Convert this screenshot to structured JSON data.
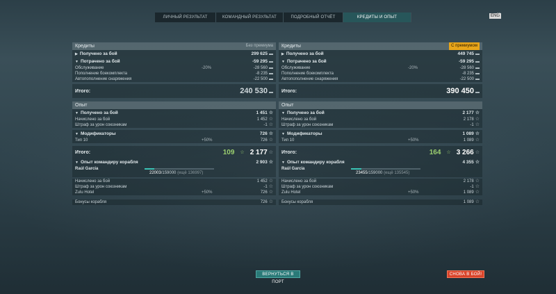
{
  "tabs": [
    {
      "label": "ЛИЧНЫЙ РЕЗУЛЬТАТ"
    },
    {
      "label": "КОМАНДНЫЙ РЕЗУЛЬТАТ"
    },
    {
      "label": "ПОДРОБНЫЙ ОТЧЁТ"
    },
    {
      "label": "КРЕДИТЫ И ОПЫТ"
    }
  ],
  "lang_badge": "ENG",
  "close_glyph": "×",
  "left": {
    "credits_header": "Кредиты",
    "credits_tag": "Без премиума",
    "earned_label": "Получено за бой",
    "earned_value": "299 625",
    "spent_label": "Потрачено за бой",
    "spent_value": "-59 295",
    "maintenance_label": "Обслуживание",
    "maintenance_mod": "-20%",
    "maintenance_value": "-28 560",
    "ammo_label": "Пополнение боекомплекта",
    "ammo_value": "-8 235",
    "consumables_label": "Автопополнение снаряжения",
    "consumables_value": "-22 500",
    "total_label": "Итого:",
    "total_value": "240 530",
    "exp_header": "Опыт",
    "exp_earned_label": "Получено за бой",
    "exp_earned_value": "1 451",
    "exp_accrued_label": "Начислено за бой",
    "exp_accrued_value": "1 452",
    "exp_penalty_label": "Штраф за урон союзникам",
    "exp_penalty_value": "-1",
    "mods_label": "Модификаторы",
    "mods_value": "726",
    "tier_label": "Тип 10",
    "tier_mod": "+50%",
    "tier_value": "726",
    "exp_total_label": "Итого:",
    "exp_total_free": "109",
    "exp_total_value": "2 177",
    "cmdr_label": "Опыт командиру корабля",
    "cmdr_value": "2 903",
    "captain_name": "Raúl Garcia",
    "cmdr_progress_current": "22003",
    "cmdr_progress_max": "/159000",
    "cmdr_progress_rest": "(ещё 136997)",
    "cmdr_progress_fraction": 0.138,
    "cmdr_accrued_label": "Начислено за бой",
    "cmdr_accrued_value": "1 452",
    "cmdr_penalty_label": "Штраф за урон союзникам",
    "cmdr_penalty_value": "-1",
    "zulu_label": "Zulu Hotel",
    "zulu_mod": "+50%",
    "zulu_value": "726",
    "bonus_label": "Бонусы корабля",
    "bonus_value": "726"
  },
  "right": {
    "credits_header": "Кредиты",
    "credits_tag": "С премиумом",
    "earned_label": "Получено за бой",
    "earned_value": "449 745",
    "spent_label": "Потрачено за бой",
    "spent_value": "-59 295",
    "maintenance_label": "Обслуживание",
    "maintenance_mod": "-20%",
    "maintenance_value": "-28 560",
    "ammo_label": "Пополнение боекомплекта",
    "ammo_value": "-8 235",
    "consumables_label": "Автопополнение снаряжения",
    "consumables_value": "-22 500",
    "total_label": "Итого:",
    "total_value": "390 450",
    "exp_header": "Опыт",
    "exp_earned_label": "Получено за бой",
    "exp_earned_value": "2 177",
    "exp_accrued_label": "Начислено за бой",
    "exp_accrued_value": "2 178",
    "exp_penalty_label": "Штраф за урон союзникам",
    "exp_penalty_value": "-1",
    "mods_label": "Модификаторы",
    "mods_value": "1 089",
    "tier_label": "Тип 10",
    "tier_mod": "+50%",
    "tier_value": "1 089",
    "exp_total_label": "Итого:",
    "exp_total_free": "164",
    "exp_total_value": "3 266",
    "cmdr_label": "Опыт командиру корабля",
    "cmdr_value": "4 355",
    "captain_name": "Raúl Garcia",
    "cmdr_progress_current": "23455",
    "cmdr_progress_max": "/159000",
    "cmdr_progress_rest": "(ещё 135545)",
    "cmdr_progress_fraction": 0.148,
    "cmdr_accrued_label": "Начислено за бой",
    "cmdr_accrued_value": "2 178",
    "cmdr_penalty_label": "Штраф за урон союзникам",
    "cmdr_penalty_value": "-1",
    "zulu_label": "Zulu Hotel",
    "zulu_mod": "+50%",
    "zulu_value": "1 089",
    "bonus_label": "Бонусы корабля",
    "bonus_value": "1 089"
  },
  "buttons": {
    "port": "ВЕРНУТЬСЯ В ПОРТ",
    "battle": "СНОВА В БОЙ!"
  },
  "colors": {
    "premium_tag": "#e8a51a",
    "active_tab": "#27565a",
    "port_button": "#2a7a78",
    "battle_button": "#d9442a",
    "free_exp": "#9bcf6f",
    "progress_fill": "#3bc3b5"
  },
  "icons": {
    "credit": "coin-icon",
    "exp": "star-icon"
  }
}
